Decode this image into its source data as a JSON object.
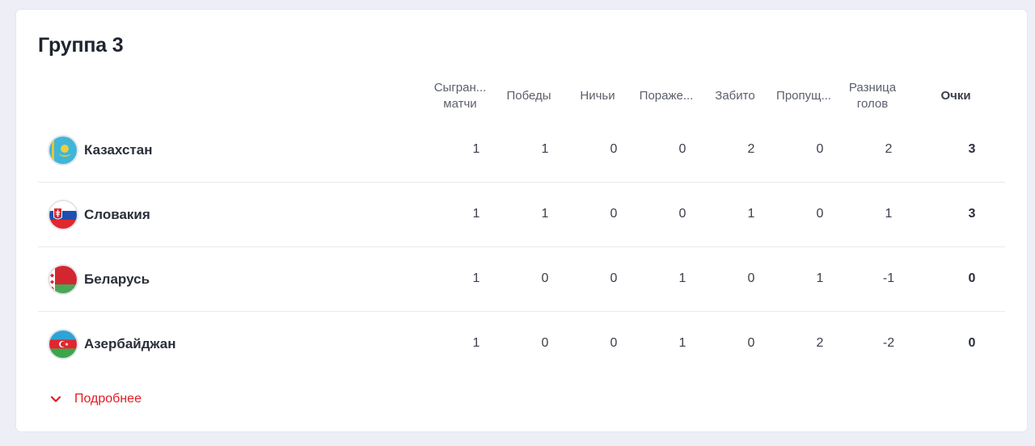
{
  "group": {
    "title": "Группа 3"
  },
  "columns": [
    {
      "key": "played",
      "lines": [
        "Сыгран...",
        "матчи"
      ]
    },
    {
      "key": "wins",
      "lines": [
        "Победы"
      ]
    },
    {
      "key": "draws",
      "lines": [
        "Ничьи"
      ]
    },
    {
      "key": "losses",
      "lines": [
        "Пораже..."
      ]
    },
    {
      "key": "scored",
      "lines": [
        "Забито"
      ]
    },
    {
      "key": "conceded",
      "lines": [
        "Пропущ..."
      ]
    },
    {
      "key": "diff",
      "lines": [
        "Разница",
        "голов"
      ]
    },
    {
      "key": "points",
      "lines": [
        "Очки"
      ]
    }
  ],
  "rows": [
    {
      "team": "Казахстан",
      "flag": "kazakhstan-flag-icon",
      "played": "1",
      "wins": "1",
      "draws": "0",
      "losses": "0",
      "scored": "2",
      "conceded": "0",
      "diff": "2",
      "points": "3"
    },
    {
      "team": "Словакия",
      "flag": "slovakia-flag-icon",
      "played": "1",
      "wins": "1",
      "draws": "0",
      "losses": "0",
      "scored": "1",
      "conceded": "0",
      "diff": "1",
      "points": "3"
    },
    {
      "team": "Беларусь",
      "flag": "belarus-flag-icon",
      "played": "1",
      "wins": "0",
      "draws": "0",
      "losses": "1",
      "scored": "0",
      "conceded": "1",
      "diff": "-1",
      "points": "0"
    },
    {
      "team": "Азербайджан",
      "flag": "azerbaijan-flag-icon",
      "played": "1",
      "wins": "0",
      "draws": "0",
      "losses": "1",
      "scored": "0",
      "conceded": "2",
      "diff": "-2",
      "points": "0"
    }
  ],
  "more": {
    "label": "Подробнее",
    "icon": "chevron-down-icon"
  },
  "colors": {
    "accent": "#e31b23",
    "background": "#eeeef6",
    "card": "#ffffff"
  }
}
